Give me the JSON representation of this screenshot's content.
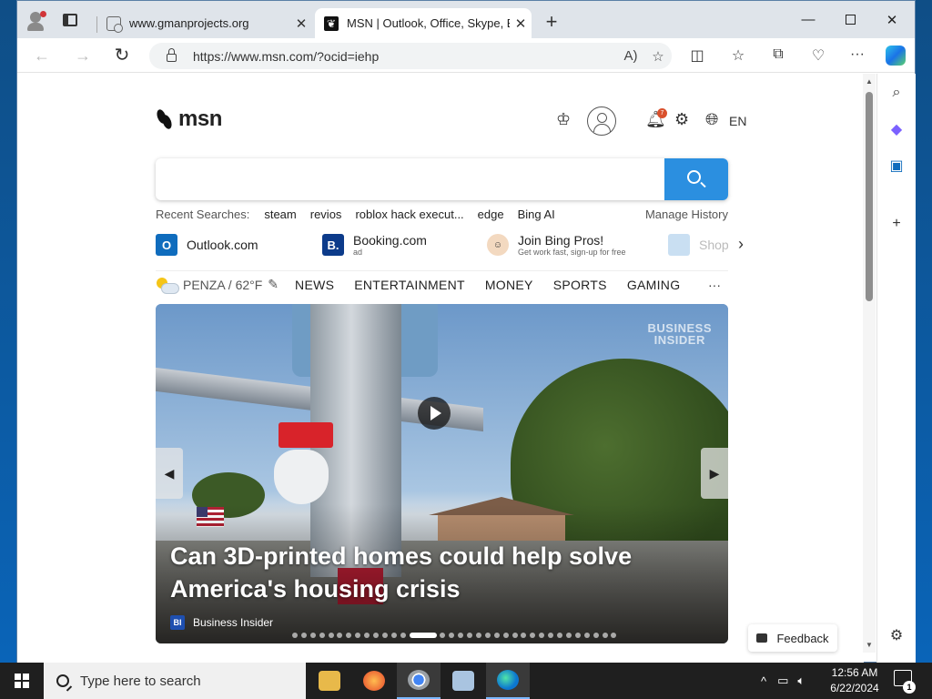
{
  "browser": {
    "tabs": [
      {
        "title": "www.gmanprojects.org",
        "close": "✕"
      },
      {
        "title": "MSN | Outlook, Office, Skype, Bing",
        "close": "✕"
      }
    ],
    "new_tab": "+",
    "url": "https://www.msn.com/?ocid=iehp",
    "window_controls": {
      "minimize": "—",
      "maximize": "",
      "close": "✕"
    }
  },
  "msn": {
    "logo_text": "msn",
    "notification_count": "7",
    "language": "EN",
    "search_placeholder": "",
    "recent_label": "Recent Searches:",
    "recent_searches": [
      "steam",
      "revios",
      "roblox hack execut...",
      "edge",
      "Bing AI"
    ],
    "manage_history": "Manage History",
    "quick_links": [
      {
        "label": "Outlook.com",
        "sub": "",
        "icon": "O"
      },
      {
        "label": "Booking.com",
        "sub": "ad",
        "icon": "B."
      },
      {
        "label": "Join Bing Pros!",
        "sub": "Get work fast, sign-up for free",
        "icon": ""
      },
      {
        "label": "Shop",
        "sub": "",
        "icon": ""
      }
    ],
    "weather": "PENZA / 62°F",
    "nav": [
      "NEWS",
      "ENTERTAINMENT",
      "MONEY",
      "SPORTS",
      "GAMING"
    ],
    "nav_more": "···",
    "hero": {
      "watermark_line1": "BUSINESS",
      "watermark_line2": "INSIDER",
      "headline": "Can 3D-printed homes could help solve America's housing crisis",
      "source": "Business Insider",
      "source_logo": "BI",
      "slide_count": 34,
      "active_slide": 13
    },
    "feedback": "Feedback"
  },
  "taskbar": {
    "search_placeholder": "Type here to search",
    "time": "12:56 AM",
    "date": "6/22/2024",
    "notifications": "1"
  },
  "colors": {
    "accent": "#2b8fe0",
    "taskbar": "#1f1f1f",
    "badge": "#d9502c"
  }
}
